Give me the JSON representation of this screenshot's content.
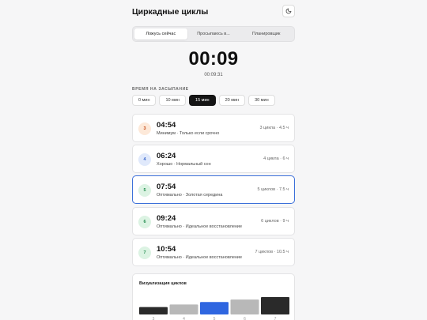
{
  "header": {
    "title": "Циркадные циклы",
    "theme_icon": "moon-icon"
  },
  "tabs": [
    {
      "label": "Ложусь сейчас",
      "active": true
    },
    {
      "label": "Просыпаюсь в...",
      "active": false
    },
    {
      "label": "Планировщик",
      "active": false
    }
  ],
  "timer": {
    "display": "00:09",
    "sub": "00:09:31"
  },
  "fall_asleep": {
    "label": "ВРЕМЯ НА ЗАСЫПАНИЕ",
    "options": [
      {
        "label": "0 мин",
        "active": false
      },
      {
        "label": "10 мин",
        "active": false
      },
      {
        "label": "15 мин",
        "active": true
      },
      {
        "label": "20 мин",
        "active": false
      },
      {
        "label": "30 мин",
        "active": false
      }
    ]
  },
  "results": [
    {
      "cycles_badge": "3",
      "time": "04:54",
      "desc": "Минимум · Только если срочно",
      "meta": "3 цикла · 4.5 ч",
      "badge_bg": "#fde9d9",
      "badge_fg": "#c2410c",
      "selected": false
    },
    {
      "cycles_badge": "4",
      "time": "06:24",
      "desc": "Хорошо · Нормальный сон",
      "meta": "4 цикла · 6 ч",
      "badge_bg": "#e0e9fb",
      "badge_fg": "#2f5fc9",
      "selected": false
    },
    {
      "cycles_badge": "5",
      "time": "07:54",
      "desc": "Оптимально · Золотая середина",
      "meta": "5 циклов · 7.5 ч",
      "badge_bg": "#dcf3e3",
      "badge_fg": "#1f8a4c",
      "selected": true
    },
    {
      "cycles_badge": "6",
      "time": "09:24",
      "desc": "Оптимально · Идеальное восстановление",
      "meta": "6 циклов · 9 ч",
      "badge_bg": "#dcf3e3",
      "badge_fg": "#1f8a4c",
      "selected": false
    },
    {
      "cycles_badge": "7",
      "time": "10:54",
      "desc": "Оптимально · Идеальное восстановление",
      "meta": "7 циклов · 10.5 ч",
      "badge_bg": "#dcf3e3",
      "badge_fg": "#1f8a4c",
      "selected": false
    }
  ],
  "visualization": {
    "title": "Визуализация циклов",
    "bars": [
      {
        "cycles": 3,
        "color": "#2a2a2a"
      },
      {
        "cycles": 4,
        "color": "#b8b8b8"
      },
      {
        "cycles": 5,
        "color": "#2f66e0"
      },
      {
        "cycles": 6,
        "color": "#b8b8b8"
      },
      {
        "cycles": 7,
        "color": "#2a2a2a"
      }
    ],
    "max_cycles": 7
  },
  "colors": {
    "accent": "#3b6fd9",
    "chip_active": "#141414"
  }
}
